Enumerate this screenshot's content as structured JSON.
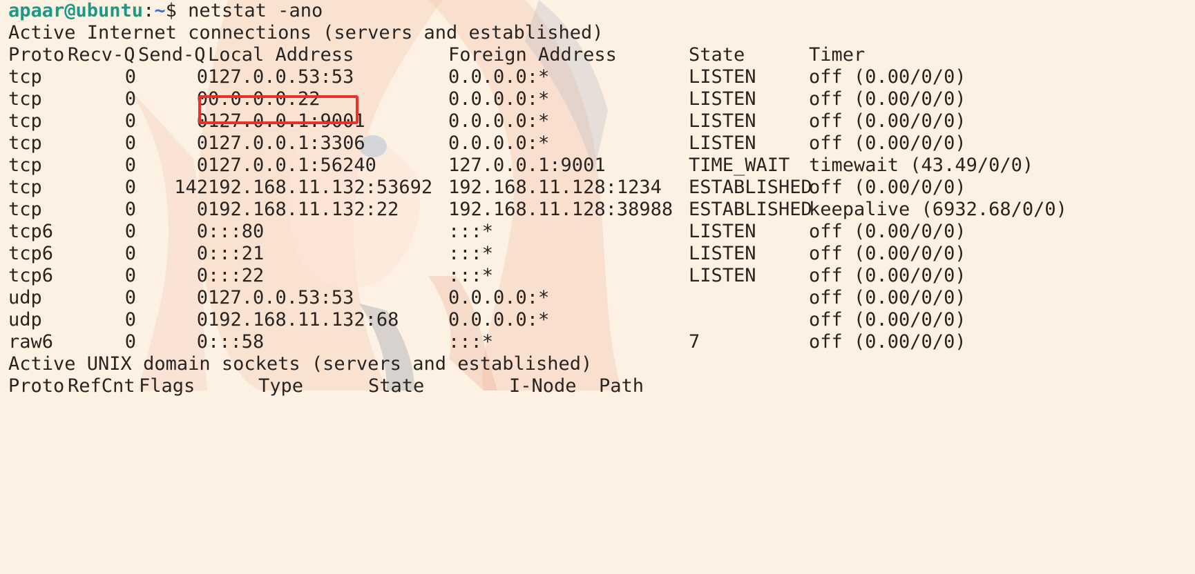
{
  "prompt": {
    "user_host": "apaar@ubuntu",
    "separator": ":",
    "path": "~",
    "symbol": "$",
    "command": "netstat -ano"
  },
  "inet_section": {
    "title": "Active Internet connections (servers and established)",
    "headers": {
      "proto": "Proto",
      "recvq": "Recv-Q",
      "sendq": "Send-Q",
      "local": "Local Address",
      "foreign": "Foreign Address",
      "state": "State",
      "timer": "Timer"
    },
    "rows": [
      {
        "proto": "tcp",
        "recvq": "0",
        "sendq": "0",
        "local": "127.0.0.53:53",
        "foreign": "0.0.0.0:*",
        "state": "LISTEN",
        "timer": "off (0.00/0/0)"
      },
      {
        "proto": "tcp",
        "recvq": "0",
        "sendq": "0",
        "local": "0.0.0.0:22",
        "foreign": "0.0.0.0:*",
        "state": "LISTEN",
        "timer": "off (0.00/0/0)"
      },
      {
        "proto": "tcp",
        "recvq": "0",
        "sendq": "0",
        "local": "127.0.0.1:9001",
        "foreign": "0.0.0.0:*",
        "state": "LISTEN",
        "timer": "off (0.00/0/0)"
      },
      {
        "proto": "tcp",
        "recvq": "0",
        "sendq": "0",
        "local": "127.0.0.1:3306",
        "foreign": "0.0.0.0:*",
        "state": "LISTEN",
        "timer": "off (0.00/0/0)"
      },
      {
        "proto": "tcp",
        "recvq": "0",
        "sendq": "0",
        "local": "127.0.0.1:56240",
        "foreign": "127.0.0.1:9001",
        "state": "TIME_WAIT",
        "timer": "timewait (43.49/0/0)"
      },
      {
        "proto": "tcp",
        "recvq": "0",
        "sendq": "142",
        "local": "192.168.11.132:53692",
        "foreign": "192.168.11.128:1234",
        "state": "ESTABLISHED",
        "timer": "off (0.00/0/0)"
      },
      {
        "proto": "tcp",
        "recvq": "0",
        "sendq": "0",
        "local": "192.168.11.132:22",
        "foreign": "192.168.11.128:38988",
        "state": "ESTABLISHED",
        "timer": "keepalive (6932.68/0/0)"
      },
      {
        "proto": "tcp6",
        "recvq": "0",
        "sendq": "0",
        "local": ":::80",
        "foreign": ":::*",
        "state": "LISTEN",
        "timer": "off (0.00/0/0)"
      },
      {
        "proto": "tcp6",
        "recvq": "0",
        "sendq": "0",
        "local": ":::21",
        "foreign": ":::*",
        "state": "LISTEN",
        "timer": "off (0.00/0/0)"
      },
      {
        "proto": "tcp6",
        "recvq": "0",
        "sendq": "0",
        "local": ":::22",
        "foreign": ":::*",
        "state": "LISTEN",
        "timer": "off (0.00/0/0)"
      },
      {
        "proto": "udp",
        "recvq": "0",
        "sendq": "0",
        "local": "127.0.0.53:53",
        "foreign": "0.0.0.0:*",
        "state": "",
        "timer": "off (0.00/0/0)"
      },
      {
        "proto": "udp",
        "recvq": "0",
        "sendq": "0",
        "local": "192.168.11.132:68",
        "foreign": "0.0.0.0:*",
        "state": "",
        "timer": "off (0.00/0/0)"
      },
      {
        "proto": "raw6",
        "recvq": "0",
        "sendq": "0",
        "local": ":::58",
        "foreign": ":::*",
        "state": "7",
        "timer": "off (0.00/0/0)"
      }
    ]
  },
  "unix_section": {
    "title": "Active UNIX domain sockets (servers and established)",
    "headers": {
      "proto": "Proto",
      "refcnt": "RefCnt",
      "flags": "Flags",
      "type": "Type",
      "state": "State",
      "inode": "I-Node",
      "path": "Path"
    }
  },
  "highlight": {
    "color": "#e5322a",
    "target": "127.0.0.1:9001"
  },
  "colors": {
    "background": "#fdf1e3",
    "text": "#2a2420",
    "prompt_user": "#1a9a84",
    "prompt_path": "#3b6fd6"
  }
}
